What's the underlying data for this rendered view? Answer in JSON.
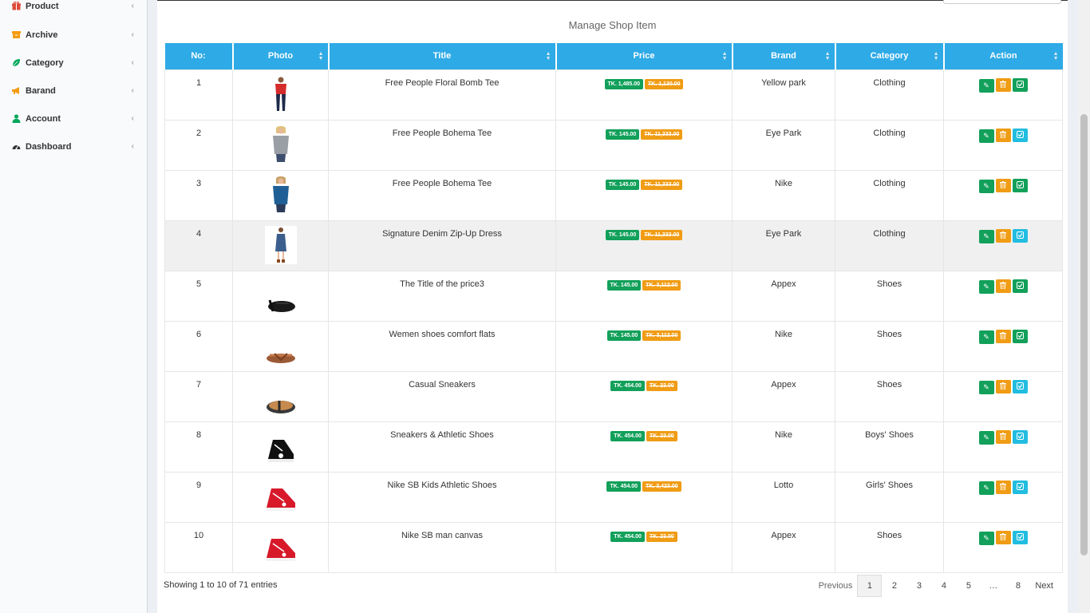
{
  "sidebar": {
    "items": [
      {
        "label": "Product",
        "icon": "gift-icon",
        "color": "#dd4b39"
      },
      {
        "label": "Archive",
        "icon": "archive-icon",
        "color": "#f39c12"
      },
      {
        "label": "Category",
        "icon": "leaf-icon",
        "color": "#00a65a"
      },
      {
        "label": "Barand",
        "icon": "bullhorn-icon",
        "color": "#f39c12"
      },
      {
        "label": "Account",
        "icon": "user-icon",
        "color": "#00a65a"
      },
      {
        "label": "Dashboard",
        "icon": "dashboard-icon",
        "color": "#333333"
      }
    ]
  },
  "page": {
    "title": "Manage Shop Item"
  },
  "table": {
    "headers": [
      "No:",
      "Photo",
      "Title",
      "Price",
      "Brand",
      "Category",
      "Action"
    ],
    "rows": [
      {
        "no": "1",
        "title": "Free People Floral Bomb Tee",
        "price": "TK. 1,485.00",
        "old": "TK. 1,130.00",
        "brand": "Yellow park",
        "category": "Clothing",
        "photo": "red-top",
        "third": "green"
      },
      {
        "no": "2",
        "title": "Free People Bohema Tee",
        "price": "TK. 145.00",
        "old": "TK. 11,333.00",
        "brand": "Eye Park",
        "category": "Clothing",
        "photo": "grey-top",
        "third": "blue"
      },
      {
        "no": "3",
        "title": "Free People Bohema Tee",
        "price": "TK. 145.00",
        "old": "TK. 11,333.00",
        "brand": "Nike",
        "category": "Clothing",
        "photo": "blue-top",
        "third": "green"
      },
      {
        "no": "4",
        "title": "Signature Denim Zip-Up Dress",
        "price": "TK. 145.00",
        "old": "TK. 11,333.00",
        "brand": "Eye Park",
        "category": "Clothing",
        "photo": "denim-dress",
        "third": "blue"
      },
      {
        "no": "5",
        "title": "The Title of the price3",
        "price": "TK. 145.00",
        "old": "TK. 3,112.00",
        "brand": "Appex",
        "category": "Shoes",
        "photo": "black-sandal",
        "third": "green"
      },
      {
        "no": "6",
        "title": "Wemen shoes comfort flats",
        "price": "TK. 145.00",
        "old": "TK. 3,112.00",
        "brand": "Nike",
        "category": "Shoes",
        "photo": "brown-sandal",
        "third": "green"
      },
      {
        "no": "7",
        "title": "Casual Sneakers",
        "price": "TK. 454.00",
        "old": "TK. 23.00",
        "brand": "Appex",
        "category": "Shoes",
        "photo": "tan-sandal",
        "third": "blue"
      },
      {
        "no": "8",
        "title": "Sneakers & Athletic Shoes",
        "price": "TK. 454.00",
        "old": "TK. 23.00",
        "brand": "Nike",
        "category": "Boys' Shoes",
        "photo": "black-sneaker",
        "third": "blue"
      },
      {
        "no": "9",
        "title": "Nike SB Kids Athletic Shoes",
        "price": "TK. 454.00",
        "old": "TK. 3,423.00",
        "brand": "Lotto",
        "category": "Girls' Shoes",
        "photo": "red-sneaker",
        "third": "blue"
      },
      {
        "no": "10",
        "title": "Nike SB man canvas",
        "price": "TK. 454.00",
        "old": "TK. 23.00",
        "brand": "Appex",
        "category": "Shoes",
        "photo": "red-sneaker",
        "third": "blue"
      }
    ]
  },
  "footer": {
    "info": "Showing 1 to 10 of 71 entries",
    "previous": "Previous",
    "pages": [
      "1",
      "2",
      "3",
      "4",
      "5",
      "…",
      "8"
    ],
    "next": "Next"
  }
}
